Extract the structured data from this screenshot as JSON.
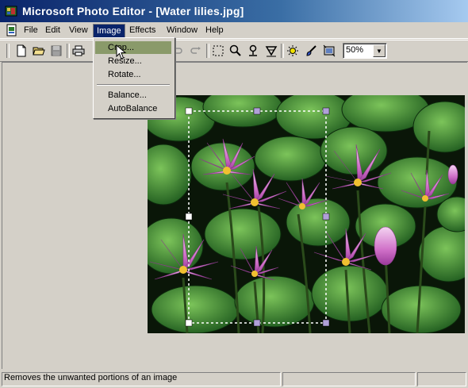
{
  "window": {
    "title": "Microsoft Photo Editor - [Water lilies.jpg]"
  },
  "menubar": {
    "items": [
      "File",
      "Edit",
      "View",
      "Image",
      "Effects",
      "Window",
      "Help"
    ],
    "active": "Image"
  },
  "image_menu": {
    "items": [
      "Crop...",
      "Resize...",
      "Rotate...",
      "Balance...",
      "AutoBalance"
    ],
    "highlighted": "Crop..."
  },
  "toolbar": {
    "icons": [
      "new-icon",
      "open-icon",
      "save-icon",
      "print-icon",
      "cut-icon",
      "copy-icon",
      "paste-icon",
      "undo-icon",
      "redo-icon",
      "select-icon",
      "zoom-icon",
      "pin-icon",
      "cone-icon",
      "sun-icon",
      "brush-icon",
      "crop-icon"
    ],
    "zoom_value": "50%"
  },
  "status": {
    "text": "Removes the unwanted portions of an image"
  },
  "colors": {
    "title_start": "#0a246a",
    "title_end": "#a6caf0",
    "menu_highlight": "#8a9a6a",
    "chrome": "#d4d0c8"
  }
}
